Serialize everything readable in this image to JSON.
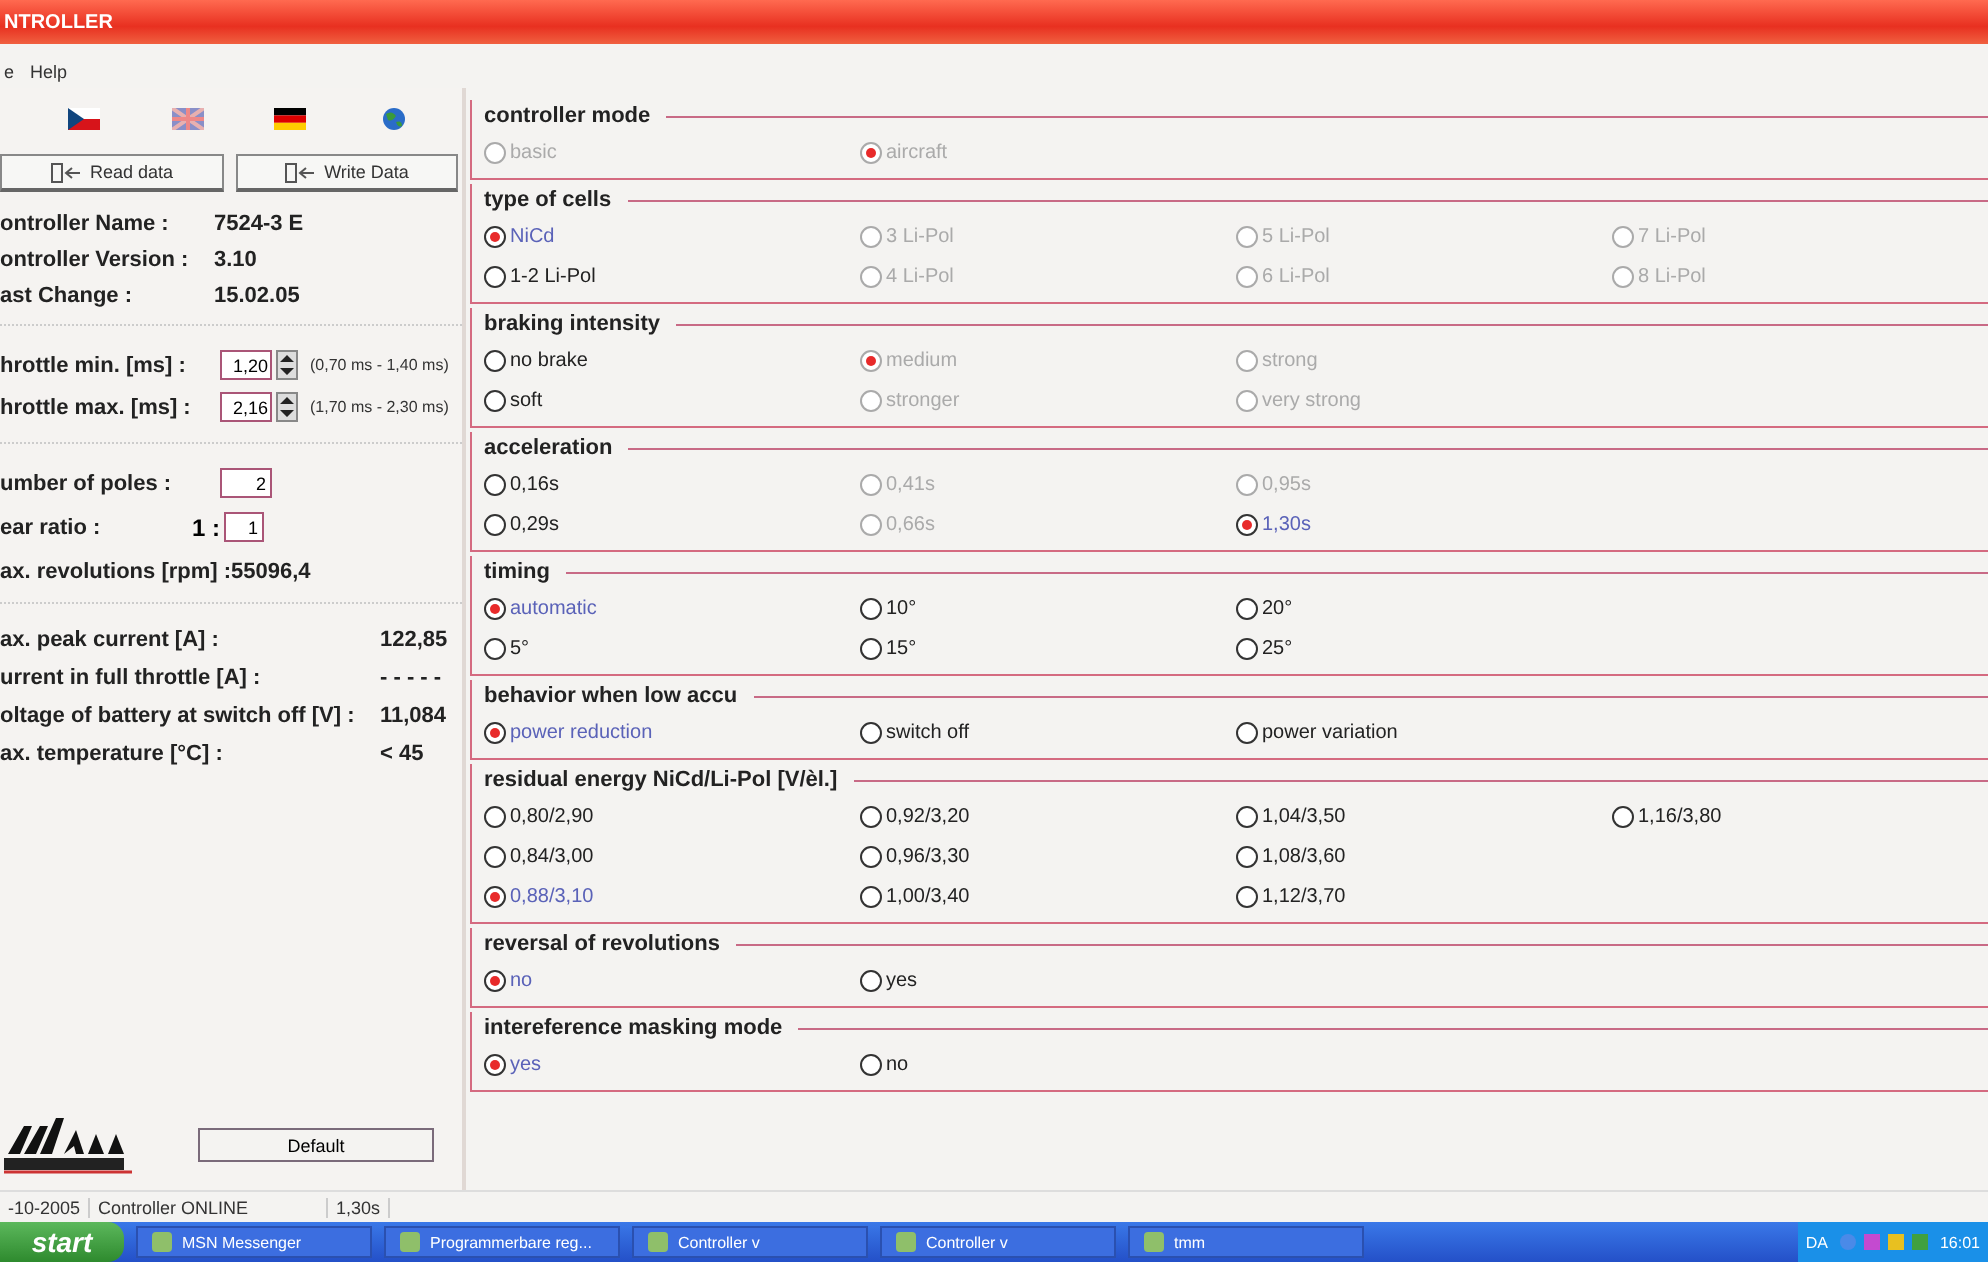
{
  "window": {
    "title": "NTROLLER"
  },
  "menu": [
    "e",
    "Help"
  ],
  "left_panel": {
    "buttons": [
      "Read data",
      "Write Data"
    ],
    "info": [
      {
        "label": "ontroller Name :",
        "value": "7524-3 E"
      },
      {
        "label": "ontroller Version :",
        "value": "3.10"
      },
      {
        "label": "ast Change :",
        "value": "15.02.05"
      }
    ],
    "throttle": [
      {
        "label": "hrottle min. [ms] :",
        "value": "1,20",
        "range": "(0,70 ms - 1,40 ms)"
      },
      {
        "label": "hrottle max. [ms] :",
        "value": "2,16",
        "range": "(1,70 ms - 2,30 ms)"
      }
    ],
    "poles": {
      "label": "umber of poles :",
      "value": "2"
    },
    "gear_ratio": {
      "label": "ear ratio :",
      "prefix": "1 :",
      "value": "1"
    },
    "max_revolutions": "ax. revolutions [rpm] :55096,4",
    "measurements": [
      {
        "label": "ax. peak current [A] :",
        "value": "122,85"
      },
      {
        "label": "urrent in full throttle [A] :",
        "value": "- - - - -"
      },
      {
        "label": "oltage of battery at switch off [V] :",
        "value": "11,084"
      },
      {
        "label": "ax. temperature [°C] :",
        "value": "< 45"
      }
    ],
    "default_button": "Default"
  },
  "groups": [
    {
      "title": "controller mode",
      "rows": [
        [
          {
            "label": "basic",
            "selected": false,
            "disabled": true
          },
          {
            "label": "aircraft",
            "selected": true,
            "disabled": true
          }
        ]
      ]
    },
    {
      "title": "type of cells",
      "rows": [
        [
          {
            "label": "NiCd",
            "selected": true,
            "disabled": false
          },
          {
            "label": "3 Li-Pol",
            "selected": false,
            "disabled": true
          },
          {
            "label": "5 Li-Pol",
            "selected": false,
            "disabled": true
          },
          {
            "label": "7 Li-Pol",
            "selected": false,
            "disabled": true
          }
        ],
        [
          {
            "label": "1-2 Li-Pol",
            "selected": false,
            "disabled": false
          },
          {
            "label": "4 Li-Pol",
            "selected": false,
            "disabled": true
          },
          {
            "label": "6 Li-Pol",
            "selected": false,
            "disabled": true
          },
          {
            "label": "8 Li-Pol",
            "selected": false,
            "disabled": true
          }
        ]
      ]
    },
    {
      "title": "braking intensity",
      "rows": [
        [
          {
            "label": "no brake",
            "selected": false,
            "disabled": false
          },
          {
            "label": "medium",
            "selected": true,
            "disabled": true
          },
          {
            "label": "strong",
            "selected": false,
            "disabled": true
          }
        ],
        [
          {
            "label": "soft",
            "selected": false,
            "disabled": false
          },
          {
            "label": "stronger",
            "selected": false,
            "disabled": true
          },
          {
            "label": "very strong",
            "selected": false,
            "disabled": true
          }
        ]
      ]
    },
    {
      "title": "acceleration",
      "rows": [
        [
          {
            "label": "0,16s",
            "selected": false,
            "disabled": false
          },
          {
            "label": "0,41s",
            "selected": false,
            "disabled": true
          },
          {
            "label": "0,95s",
            "selected": false,
            "disabled": true
          }
        ],
        [
          {
            "label": "0,29s",
            "selected": false,
            "disabled": false
          },
          {
            "label": "0,66s",
            "selected": false,
            "disabled": true
          },
          {
            "label": "1,30s",
            "selected": true,
            "disabled": false
          }
        ]
      ]
    },
    {
      "title": "timing",
      "rows": [
        [
          {
            "label": "automatic",
            "selected": true,
            "disabled": false
          },
          {
            "label": "10°",
            "selected": false,
            "disabled": false
          },
          {
            "label": "20°",
            "selected": false,
            "disabled": false
          }
        ],
        [
          {
            "label": "5°",
            "selected": false,
            "disabled": false
          },
          {
            "label": "15°",
            "selected": false,
            "disabled": false
          },
          {
            "label": "25°",
            "selected": false,
            "disabled": false
          }
        ]
      ]
    },
    {
      "title": "behavior when low accu",
      "rows": [
        [
          {
            "label": "power reduction",
            "selected": true,
            "disabled": false
          },
          {
            "label": "switch off",
            "selected": false,
            "disabled": false
          },
          {
            "label": "power variation",
            "selected": false,
            "disabled": false
          }
        ]
      ]
    },
    {
      "title": "residual energy NiCd/Li-Pol [V/èl.]",
      "rows": [
        [
          {
            "label": "0,80/2,90",
            "selected": false,
            "disabled": false
          },
          {
            "label": "0,92/3,20",
            "selected": false,
            "disabled": false
          },
          {
            "label": "1,04/3,50",
            "selected": false,
            "disabled": false
          },
          {
            "label": "1,16/3,80",
            "selected": false,
            "disabled": false
          }
        ],
        [
          {
            "label": "0,84/3,00",
            "selected": false,
            "disabled": false
          },
          {
            "label": "0,96/3,30",
            "selected": false,
            "disabled": false
          },
          {
            "label": "1,08/3,60",
            "selected": false,
            "disabled": false
          }
        ],
        [
          {
            "label": "0,88/3,10",
            "selected": true,
            "disabled": false
          },
          {
            "label": "1,00/3,40",
            "selected": false,
            "disabled": false
          },
          {
            "label": "1,12/3,70",
            "selected": false,
            "disabled": false
          }
        ]
      ]
    },
    {
      "title": "reversal of revolutions",
      "rows": [
        [
          {
            "label": "no",
            "selected": true,
            "disabled": false
          },
          {
            "label": "yes",
            "selected": false,
            "disabled": false
          }
        ]
      ]
    },
    {
      "title": "intereference masking mode",
      "rows": [
        [
          {
            "label": "yes",
            "selected": true,
            "disabled": false
          },
          {
            "label": "no",
            "selected": false,
            "disabled": false
          }
        ]
      ]
    }
  ],
  "status_bar": [
    "-10-2005",
    "Controller ONLINE",
    "1,30s"
  ],
  "taskbar": {
    "start": "start",
    "items": [
      "MSN Messenger",
      "Programmerbare reg...",
      "Controller v",
      "Controller v",
      "tmm"
    ],
    "language": "DA",
    "clock": "16:01"
  }
}
